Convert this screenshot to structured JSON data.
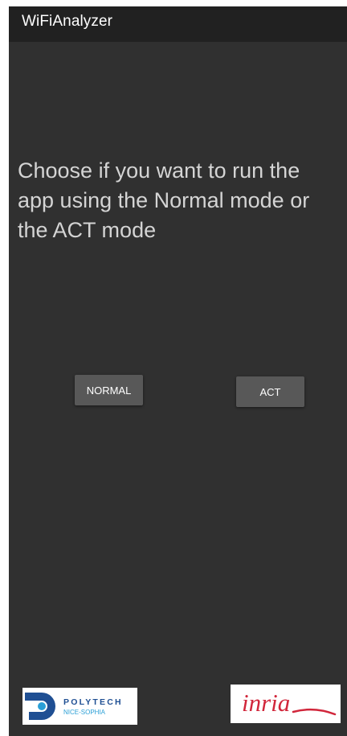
{
  "app": {
    "title": "WiFiAnalyzer"
  },
  "main": {
    "prompt": "Choose if you want to run the app using the Normal mode or the ACT mode"
  },
  "buttons": {
    "normal_label": "NORMAL",
    "act_label": "ACT"
  },
  "logos": {
    "polytech": {
      "name": "POLYTECH",
      "subtitle": "NICE-SOPHIA"
    },
    "inria": {
      "name": "Inria"
    }
  },
  "colors": {
    "app_bar": "#212121",
    "background": "#303030",
    "button": "#585858",
    "prompt_text": "#d4d4d4",
    "polytech_blue": "#1f4f93",
    "polytech_light_blue": "#2a9fd6",
    "inria_red": "#d1263b"
  }
}
